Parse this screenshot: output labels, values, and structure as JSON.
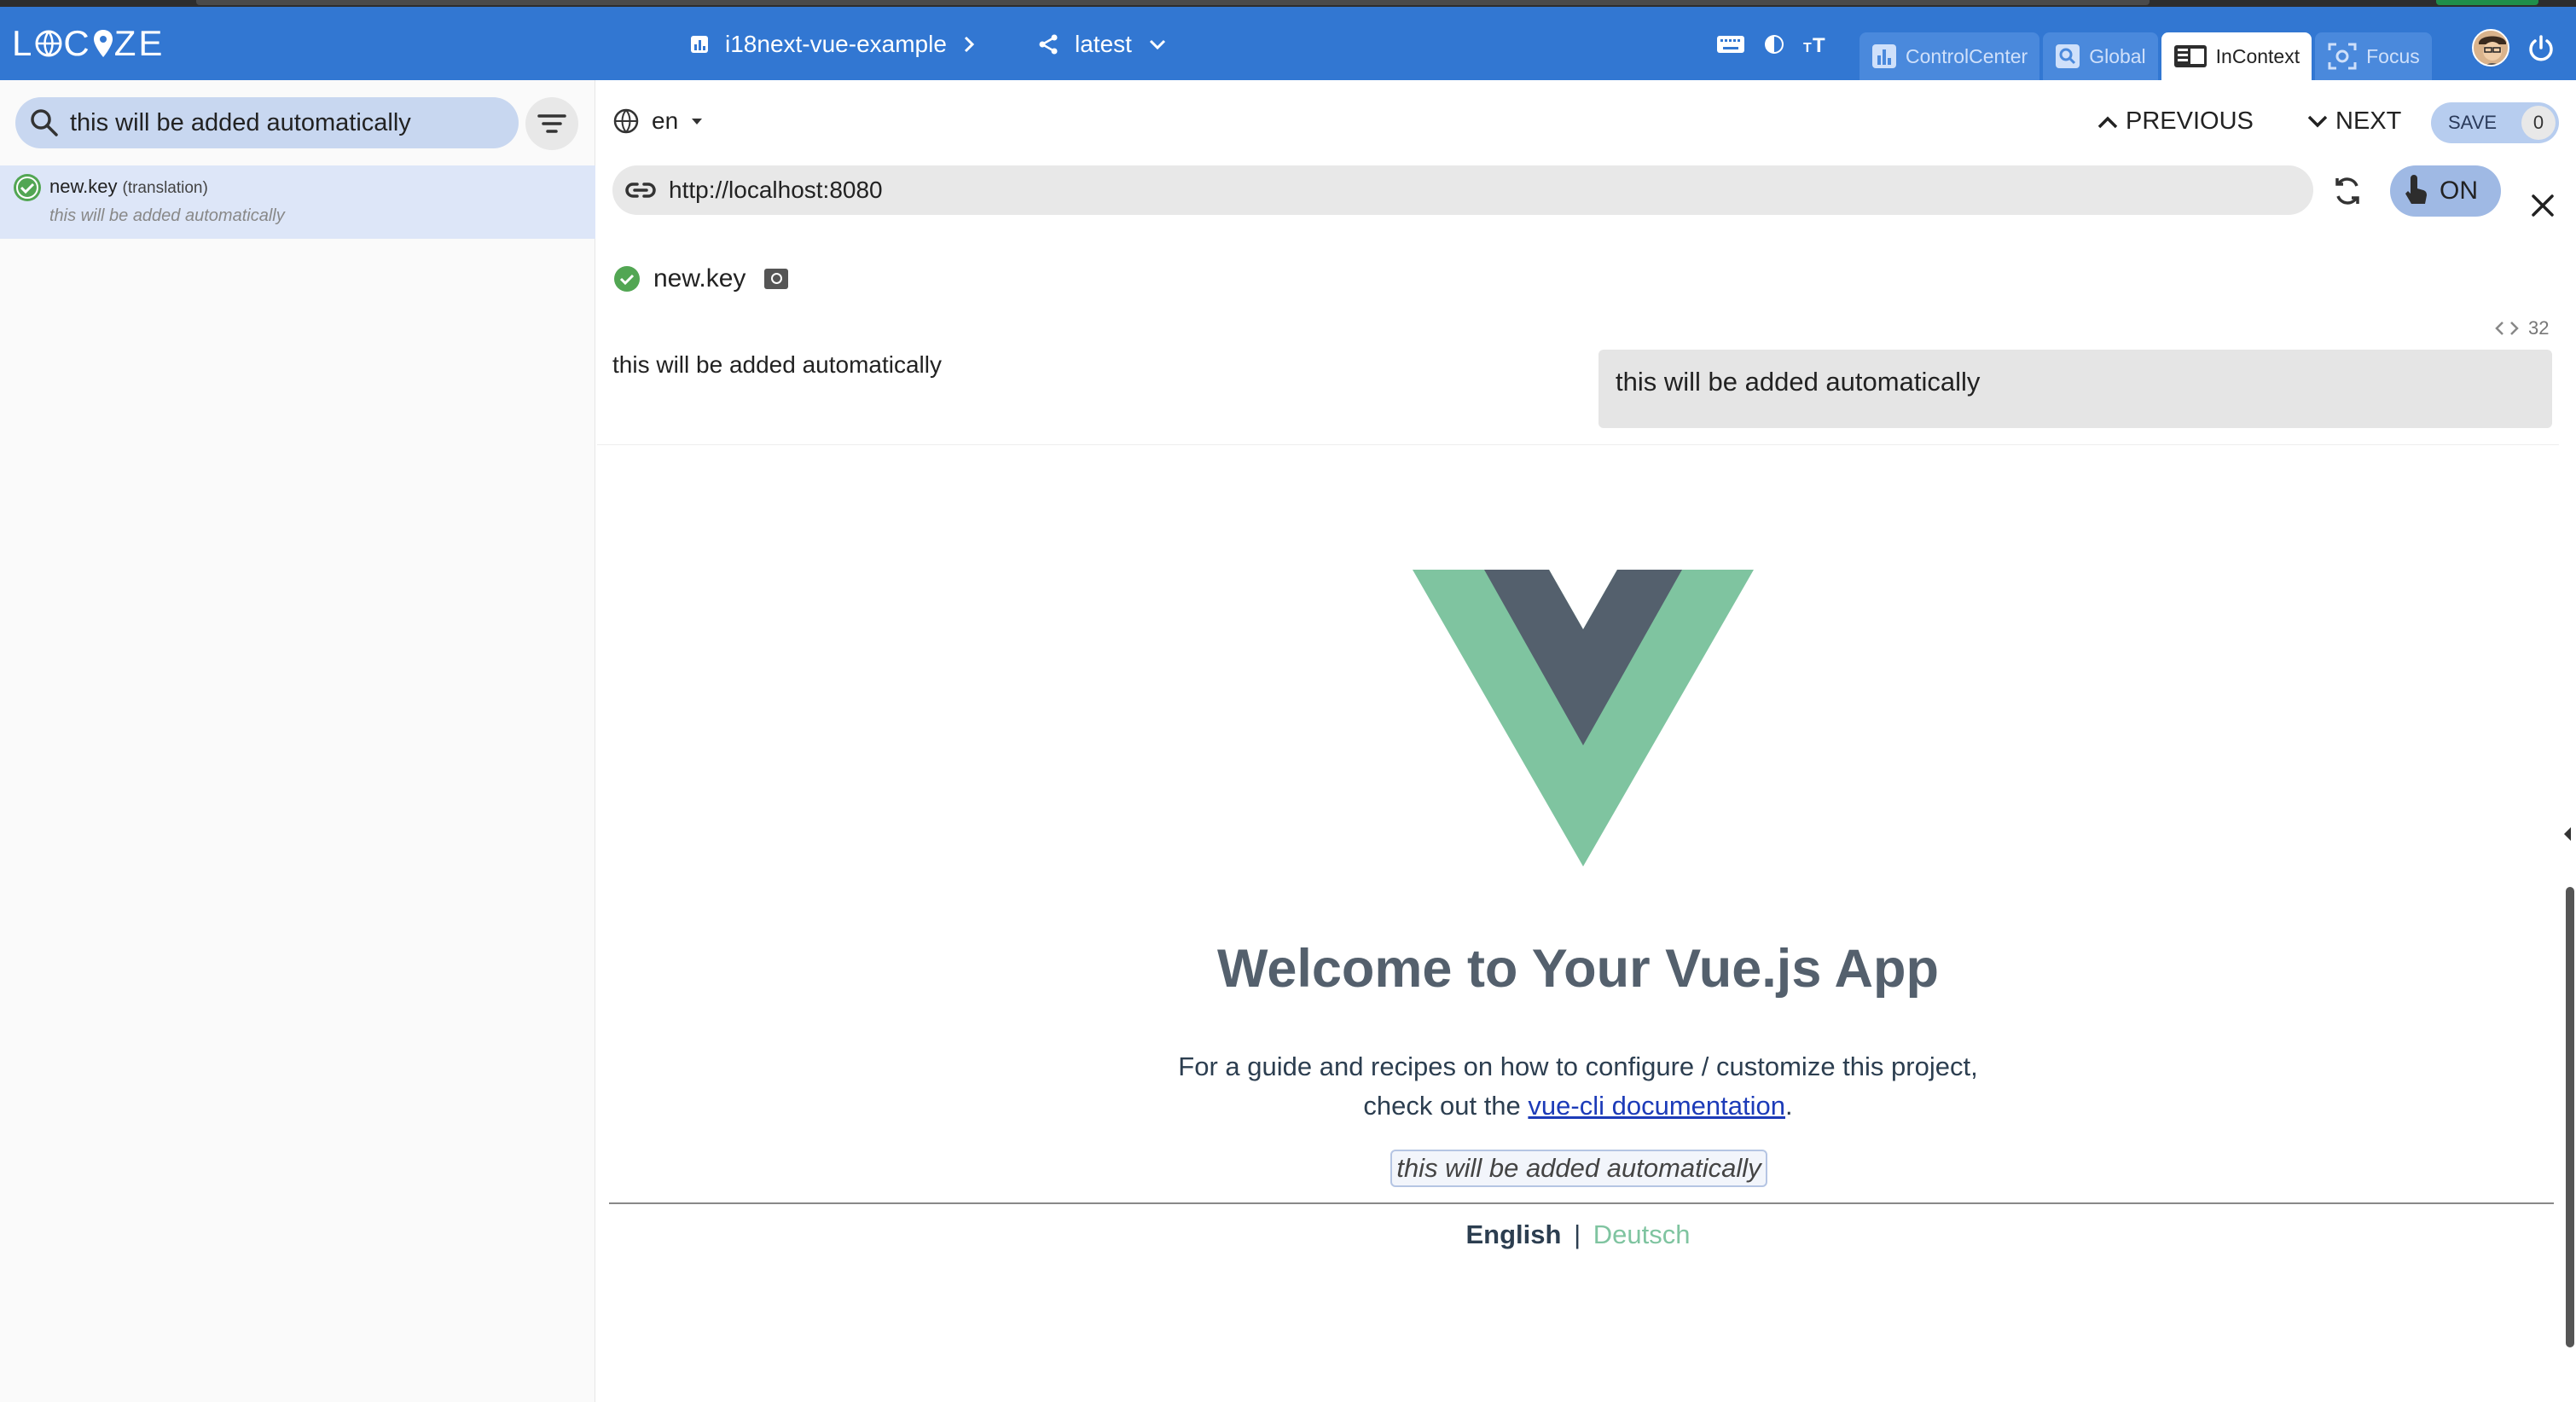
{
  "header": {
    "logo": "LOCIZE",
    "project": "i18next-vue-example",
    "version": "latest",
    "modes": [
      {
        "label": "ControlCenter",
        "active": false
      },
      {
        "label": "Global",
        "active": false
      },
      {
        "label": "InContext",
        "active": true
      },
      {
        "label": "Focus",
        "active": false
      }
    ],
    "colors": {
      "header_bg": "#3277d2",
      "accent": "#3277d2",
      "vue_green": "#7fc4a0",
      "vue_dark": "#54606d"
    }
  },
  "sidebar": {
    "search_value": "this will be added automatically",
    "items": [
      {
        "key": "new.key",
        "namespace": "(translation)",
        "value": "this will be added automatically"
      }
    ]
  },
  "toolbar": {
    "language": "en",
    "previous_label": "PREVIOUS",
    "next_label": "NEXT",
    "save_label": "SAVE",
    "save_count": "0"
  },
  "urlbar": {
    "url": "http://localhost:8080",
    "toggle_label": "ON"
  },
  "editor": {
    "key": "new.key",
    "source_text": "this will be added automatically",
    "char_count": "32",
    "target_text": "this will be added automatically"
  },
  "preview": {
    "title": "Welcome to Your Vue.js App",
    "guide_line1": "For a guide and recipes on how to configure / customize this project,",
    "guide_line2_prefix": "check out the",
    "guide_link": "vue-cli documentation",
    "guide_line2_suffix": ".",
    "added_text": "this will be added automatically",
    "lang_en": "English",
    "lang_sep": "|",
    "lang_de": "Deutsch"
  }
}
